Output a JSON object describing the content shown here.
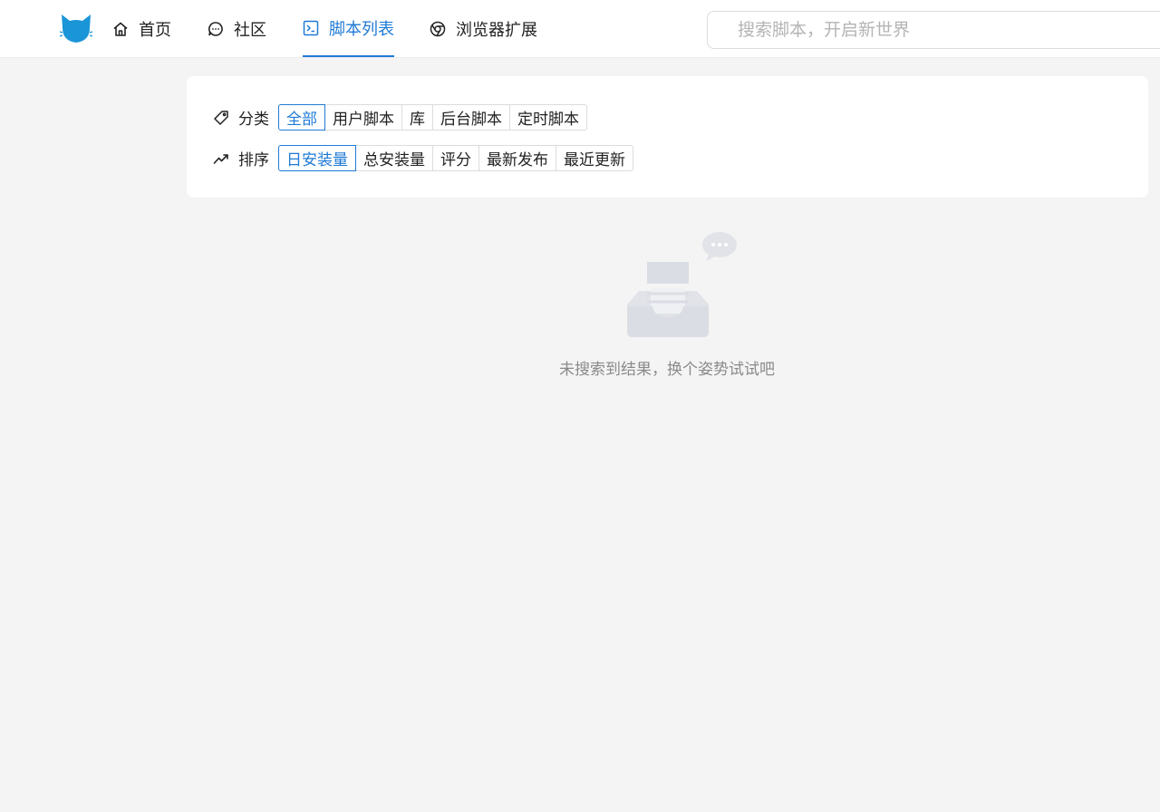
{
  "header": {
    "logo_icon": "cat-logo-icon",
    "accent_color": "#1f7ad6",
    "nav": [
      {
        "label": "首页",
        "icon": "home-icon"
      },
      {
        "label": "社区",
        "icon": "chat-bubble-icon"
      },
      {
        "label": "脚本列表",
        "icon": "terminal-icon",
        "active": true
      },
      {
        "label": "浏览器扩展",
        "icon": "chrome-icon"
      }
    ],
    "search": {
      "placeholder": "搜索脚本，开启新世界",
      "value": ""
    }
  },
  "filters": {
    "category": {
      "label": "分类",
      "icon": "tag-icon",
      "options": [
        "全部",
        "用户脚本",
        "库",
        "后台脚本",
        "定时脚本"
      ],
      "selected": "全部"
    },
    "sort": {
      "label": "排序",
      "icon": "trending-up-icon",
      "options": [
        "日安装量",
        "总安装量",
        "评分",
        "最新发布",
        "最近更新"
      ],
      "selected": "日安装量"
    }
  },
  "empty_state": {
    "icon": "empty-inbox-icon",
    "message": "未搜索到结果，换个姿势试试吧"
  }
}
